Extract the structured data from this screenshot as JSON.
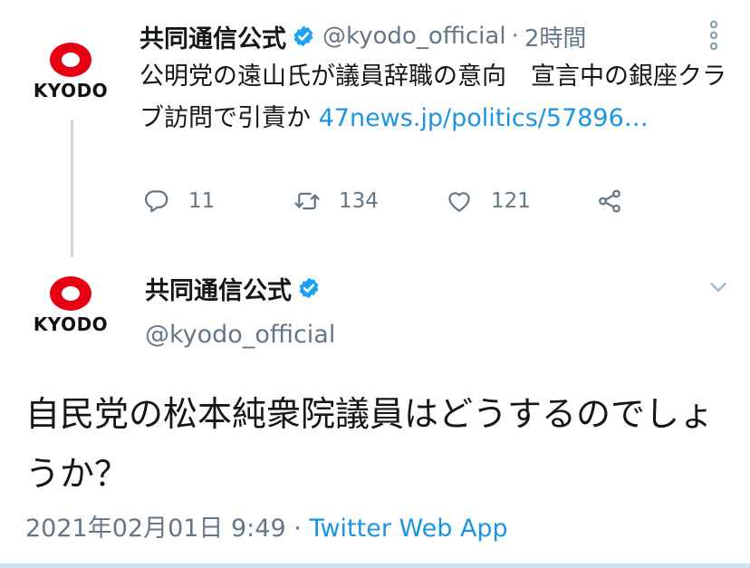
{
  "colors": {
    "text": "#14171a",
    "secondary": "#657786",
    "link": "#1b95e0",
    "verified": "#1da1f2",
    "logo_red": "#e60012",
    "thread_line": "#ccd6dd"
  },
  "reply_tweet": {
    "logo_text": "KYODO",
    "name": "共同通信公式",
    "handle": "@kyodo_official",
    "separator": "·",
    "time": "2時間",
    "text": "公明党の遠山氏が議員辞職の意向　宣言中の銀座クラブ訪問で引責か ",
    "link": "47news.jp/politics/57896…",
    "actions": {
      "reply_count": "11",
      "retweet_count": "134",
      "like_count": "121"
    },
    "icons": [
      "verified-badge-icon",
      "more-vertical-icon",
      "reply-icon",
      "retweet-icon",
      "like-icon",
      "share-icon"
    ]
  },
  "main_tweet": {
    "logo_text": "KYODO",
    "name": "共同通信公式",
    "handle": "@kyodo_official",
    "text": "自民党の松本純衆院議員はどうするのでしょうか？",
    "timestamp": "2021年02月01日 9:49",
    "separator": "·",
    "source": "Twitter Web App",
    "icons": [
      "verified-badge-icon",
      "chevron-down-icon"
    ]
  }
}
